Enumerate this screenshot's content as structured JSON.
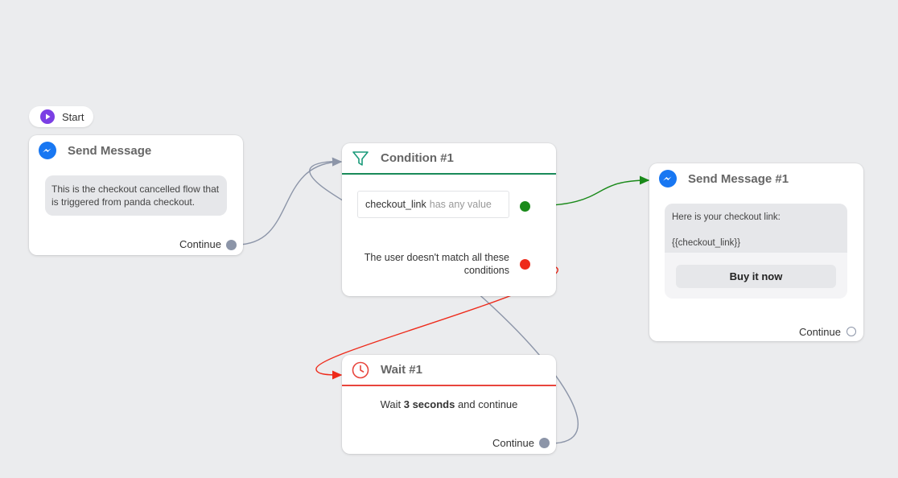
{
  "start": {
    "label": "Start",
    "icon": "play-icon"
  },
  "send_message": {
    "title": "Send Message",
    "icon": "messenger-icon",
    "message": "This is the checkout cancelled flow that is triggered from panda checkout.",
    "continue_label": "Continue"
  },
  "condition": {
    "title": "Condition #1",
    "icon": "filter-icon",
    "accent": "#1a8a5a",
    "rule_field": "checkout_link",
    "rule_operator": "has any value",
    "else_label": "The user doesn't match all these conditions"
  },
  "send_message_1": {
    "title": "Send Message #1",
    "icon": "messenger-icon",
    "text_line1": "Here is your checkout link:",
    "text_line2": "{{checkout_link}}",
    "button_label": "Buy it now",
    "continue_label": "Continue"
  },
  "wait": {
    "title": "Wait #1",
    "icon": "clock-icon",
    "accent": "#e8453c",
    "text_prefix": "Wait ",
    "text_bold": "3 seconds",
    "text_suffix": " and continue",
    "continue_label": "Continue"
  },
  "colors": {
    "background": "#ebecee",
    "messenger": "#1877f2",
    "start": "#7b3fe4",
    "link_grey": "#8c95a8",
    "link_green": "#1a8a1a",
    "link_red": "#ee2a1a"
  }
}
